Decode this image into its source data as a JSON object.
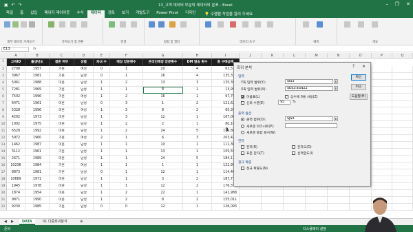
{
  "window": {
    "qat_icons": [
      "save-icon",
      "undo-icon",
      "redo-icon"
    ],
    "title": "13_고객 데이터 부분의 데이터의 분포 - Excel",
    "controls": [
      "minimize",
      "restore",
      "close"
    ]
  },
  "ribbon_tabs": [
    "파일",
    "홈",
    "삽입",
    "페이지 레이아웃",
    "수식",
    "데이터",
    "검토",
    "보기",
    "개발도구",
    "Power Pivot",
    "디자인"
  ],
  "active_tab": "데이터",
  "tell_me": "수행할 작업을 알려 주세요.",
  "ribbon_groups": [
    {
      "label": "외부 데이터 가져오기"
    },
    {
      "label": "가져오기 및 변환"
    },
    {
      "label": "연결"
    },
    {
      "label": "정렬 및 필터"
    },
    {
      "label": "데이터 도구"
    },
    {
      "label": "예측"
    },
    {
      "label": "개요"
    }
  ],
  "formula_bar": {
    "namebox": "E13",
    "fx": "fx"
  },
  "columns": [
    "A",
    "B",
    "C",
    "D",
    "E",
    "F",
    "G",
    "H",
    "I",
    "J",
    "K",
    "L",
    "M",
    "N",
    "O",
    "P",
    "Q"
  ],
  "table": {
    "headers": [
      "고객ID",
      "출생년도",
      "결혼 여부",
      "성별",
      "자녀 수",
      "매장 방문횟수",
      "온라인매장 방문횟수",
      "DM 발송 횟수",
      "총 구매금액"
    ],
    "rows": [
      [
        "2708",
        "1957",
        "기혼",
        "여성",
        "0",
        "1",
        "20",
        "4",
        "61,574"
      ],
      [
        "3967",
        "1981",
        "기혼",
        "남성",
        "0",
        "1",
        "26",
        "4",
        "135,339"
      ],
      [
        "5061",
        "1988",
        "미혼",
        "남성",
        "1",
        "2",
        "13",
        "3",
        "135,399"
      ],
      [
        "7281",
        "1969",
        "기혼",
        "남성",
        "1",
        "1",
        "8",
        "1",
        "13,996"
      ],
      [
        "7502",
        "1996",
        "기혼",
        "여성",
        "1",
        "2",
        "16",
        "1",
        "97,759"
      ],
      [
        "6471",
        "1961",
        "미혼",
        "남성",
        "0",
        "3",
        "1",
        "2",
        "121,626"
      ],
      [
        "5328",
        "1996",
        "미혼",
        "여성",
        "1",
        "3",
        "8",
        "2",
        "65,395"
      ],
      [
        "4202",
        "1973",
        "미혼",
        "남성",
        "1",
        "3",
        "12",
        "1",
        "167,066"
      ],
      [
        "1002",
        "1975",
        "미혼",
        "남성",
        "1",
        "2",
        "2",
        "1",
        "80,102"
      ],
      [
        "6528",
        "1992",
        "미혼",
        "남성",
        "1",
        "2",
        "24",
        "5",
        "179,880"
      ],
      [
        "5972",
        "1960",
        "기혼",
        "여성",
        "2",
        "1",
        "6",
        "3",
        "203,427"
      ],
      [
        "1462",
        "1987",
        "미혼",
        "남성",
        "1",
        "1",
        "10",
        "1",
        "111,364"
      ],
      [
        "3112",
        "1961",
        "기혼",
        "남성",
        "1",
        "1",
        "13",
        "1",
        "155,551"
      ],
      [
        "2671",
        "1989",
        "미혼",
        "남성",
        "1",
        "1",
        "24",
        "5",
        "184,114"
      ],
      [
        "10236",
        "1984",
        "기혼",
        "여성",
        "1",
        "1",
        "1",
        "1",
        "122,950"
      ],
      [
        "8873",
        "1981",
        "기혼",
        "남성",
        "0",
        "1",
        "12",
        "1",
        "114,465"
      ],
      [
        "10689",
        "1971",
        "미혼",
        "남성",
        "1",
        "1",
        "3",
        "2",
        "187,717"
      ],
      [
        "1945",
        "1978",
        "미혼",
        "남성",
        "1",
        "1",
        "12",
        "2",
        "176,375"
      ],
      [
        "1874",
        "1954",
        "미혼",
        "남성",
        "1",
        "2",
        "22",
        "1",
        "141,988"
      ],
      [
        "9871",
        "1990",
        "미혼",
        "남성",
        "1",
        "2",
        "8",
        "2",
        "155,011"
      ],
      [
        "9230",
        "1985",
        "기혼",
        "남성",
        "0",
        "0",
        "12",
        "1",
        "126,093"
      ]
    ]
  },
  "row_numbers": [
    "1",
    "2",
    "3",
    "4",
    "5",
    "6",
    "7",
    "8",
    "9",
    "10",
    "11",
    "12",
    "13",
    "14",
    "15",
    "16",
    "17",
    "18",
    "19",
    "20",
    "21",
    "22"
  ],
  "sheet_tabs": [
    "DATA",
    "01 다중회귀분석"
  ],
  "statusbar": {
    "left": "준비",
    "right": "디스플레이 설정"
  },
  "dialog": {
    "title": "회귀 분석",
    "section_input": "입력",
    "y_label": "Y축 입력 범위(Y):",
    "y_value": "$I$3",
    "x_label": "X축 입력 범위(X):",
    "x_value": "$E$3:$G$22",
    "chk_labels": "이름표(L)",
    "chk_const": "상수에 0을 사용(Z)",
    "chk_conf": "신뢰 수준(E)",
    "conf_value": "95",
    "conf_unit": "%",
    "section_output": "출력 옵션",
    "opt_range": "출력 범위(O):",
    "range_value": "$J$4",
    "opt_newsheet": "새로운 워크시트(P):",
    "opt_newbook": "새로운 통합 문서(W)",
    "section_resid": "잔차",
    "chk_resid": "잔차(R)",
    "chk_std_resid": "표준 잔차(T)",
    "chk_resid_plot": "잔차도(D)",
    "chk_line_plot": "선적합도(I)",
    "section_normal": "정규 확률",
    "chk_normal": "정규 확률도(N)",
    "btn_ok": "확인",
    "btn_cancel": "취소",
    "btn_help": "도움말(H)"
  }
}
